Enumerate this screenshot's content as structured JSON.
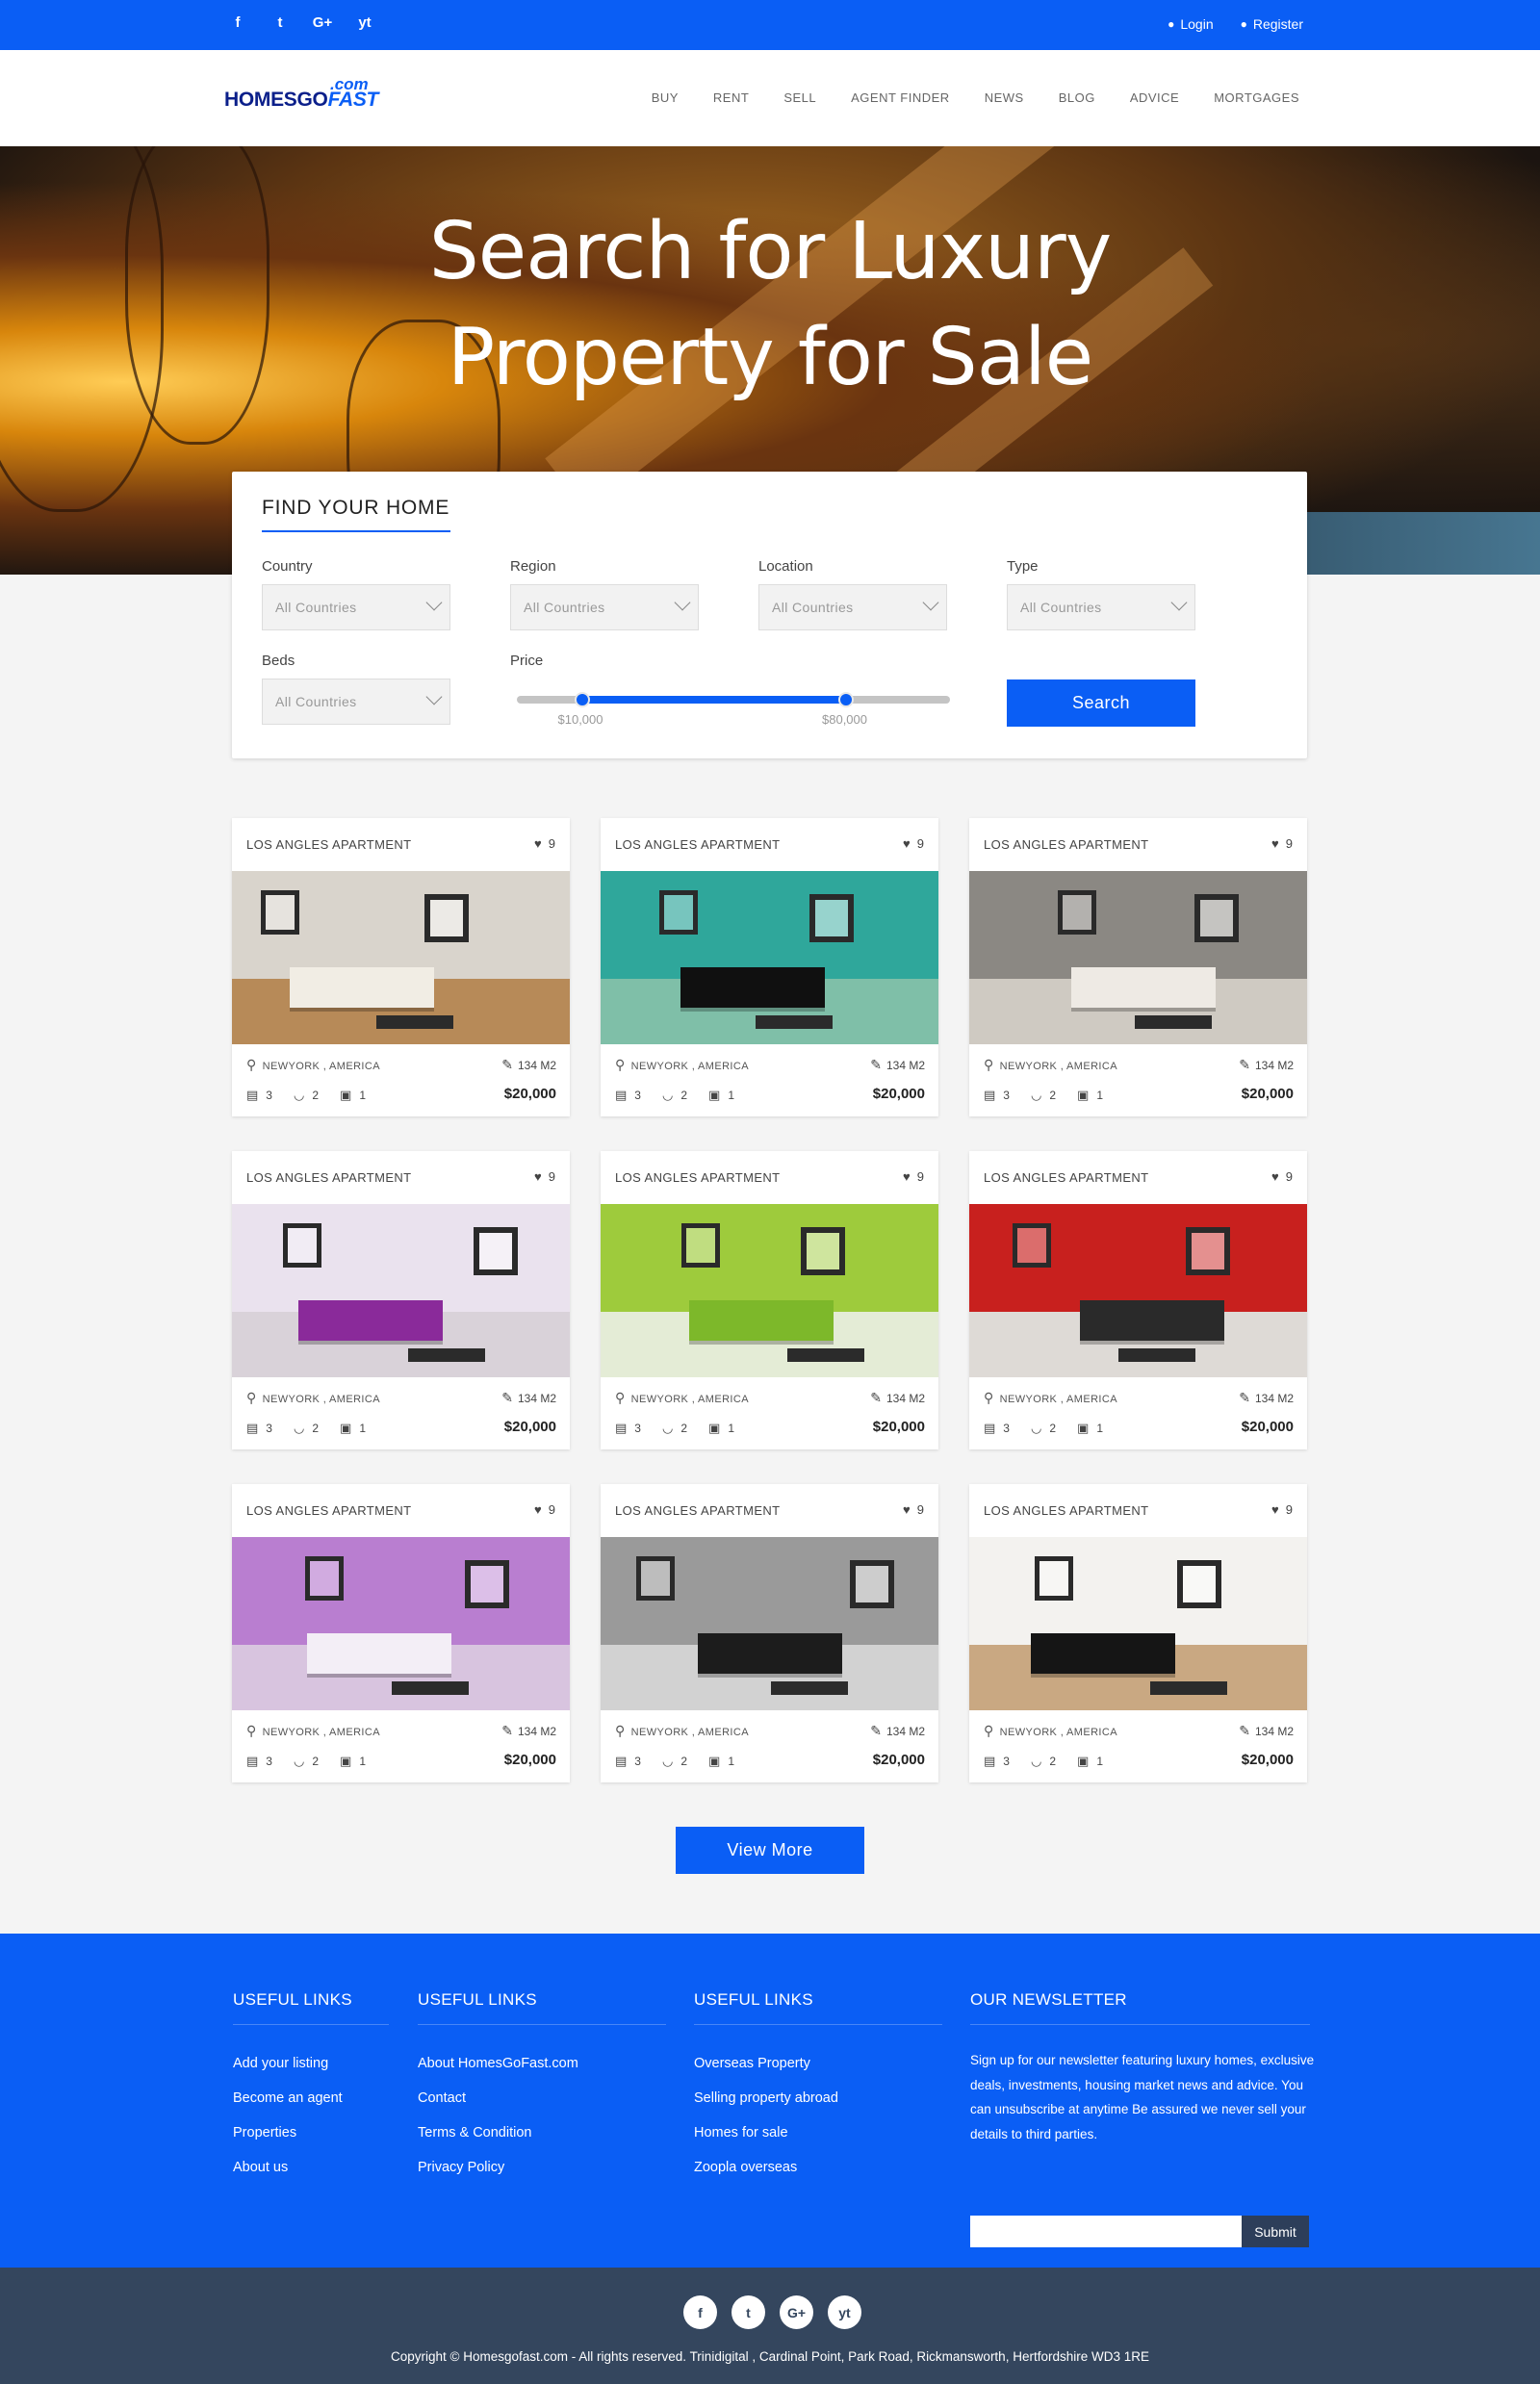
{
  "topbar": {
    "social": [
      "f",
      "t",
      "G+",
      "yt"
    ],
    "login": "Login",
    "register": "Register"
  },
  "logo": {
    "dotcom": ".com",
    "word_a": "HOMESGO",
    "word_b": "FAST"
  },
  "nav": [
    "BUY",
    "RENT",
    "SELL",
    "AGENT FINDER",
    "NEWS",
    "BLOG",
    "ADVICE",
    "MORTGAGES"
  ],
  "hero": {
    "line1": "Search for Luxury",
    "line2": "Property for Sale"
  },
  "search": {
    "title": "FIND YOUR HOME",
    "country": {
      "label": "Country",
      "value": "All Countries"
    },
    "region": {
      "label": "Region",
      "value": "All Countries"
    },
    "location": {
      "label": "Location",
      "value": "All Countries"
    },
    "type": {
      "label": "Type",
      "value": "All Countries"
    },
    "beds": {
      "label": "Beds",
      "value": "All Countries"
    },
    "price": {
      "label": "Price",
      "min": "$10,000",
      "max": "$80,000",
      "min_fraction": 0.15,
      "max_fraction": 0.76
    },
    "button": "Search"
  },
  "listings": [
    {
      "title": "LOS ANGLES APARTMENT",
      "likes": "9",
      "location": "NEWYORK , AMERICA",
      "area": "134 M2",
      "beds": "3",
      "baths": "2",
      "garage": "1",
      "price": "$20,000",
      "wall": "#d9d4cc",
      "floor": "#b78a58",
      "accent": "#f1ede4"
    },
    {
      "title": "LOS ANGLES APARTMENT",
      "likes": "9",
      "location": "NEWYORK , AMERICA",
      "area": "134 M2",
      "beds": "3",
      "baths": "2",
      "garage": "1",
      "price": "$20,000",
      "wall": "#2fa79b",
      "floor": "#7fbfa8",
      "accent": "#101010"
    },
    {
      "title": "LOS ANGLES APARTMENT",
      "likes": "9",
      "location": "NEWYORK , AMERICA",
      "area": "134 M2",
      "beds": "3",
      "baths": "2",
      "garage": "1",
      "price": "$20,000",
      "wall": "#8b8883",
      "floor": "#cfcac2",
      "accent": "#eeeae4"
    },
    {
      "title": "LOS ANGLES APARTMENT",
      "likes": "9",
      "location": "NEWYORK , AMERICA",
      "area": "134 M2",
      "beds": "3",
      "baths": "2",
      "garage": "1",
      "price": "$20,000",
      "wall": "#eae2ee",
      "floor": "#d9d2d9",
      "accent": "#8a2a9a"
    },
    {
      "title": "LOS ANGLES APARTMENT",
      "likes": "9",
      "location": "NEWYORK , AMERICA",
      "area": "134 M2",
      "beds": "3",
      "baths": "2",
      "garage": "1",
      "price": "$20,000",
      "wall": "#9ecb3c",
      "floor": "#e4ecd6",
      "accent": "#7db82a"
    },
    {
      "title": "LOS ANGLES APARTMENT",
      "likes": "9",
      "location": "NEWYORK , AMERICA",
      "area": "134 M2",
      "beds": "3",
      "baths": "2",
      "garage": "1",
      "price": "$20,000",
      "wall": "#c8201e",
      "floor": "#dedad6",
      "accent": "#2a2a2a"
    },
    {
      "title": "LOS ANGLES APARTMENT",
      "likes": "9",
      "location": "NEWYORK , AMERICA",
      "area": "134 M2",
      "beds": "3",
      "baths": "2",
      "garage": "1",
      "price": "$20,000",
      "wall": "#b97ed0",
      "floor": "#d8c4df",
      "accent": "#f3eef6"
    },
    {
      "title": "LOS ANGLES APARTMENT",
      "likes": "9",
      "location": "NEWYORK , AMERICA",
      "area": "134 M2",
      "beds": "3",
      "baths": "2",
      "garage": "1",
      "price": "$20,000",
      "wall": "#9a9a9a",
      "floor": "#d2d2d2",
      "accent": "#1c1c1c"
    },
    {
      "title": "LOS ANGLES APARTMENT",
      "likes": "9",
      "location": "NEWYORK , AMERICA",
      "area": "134 M2",
      "beds": "3",
      "baths": "2",
      "garage": "1",
      "price": "$20,000",
      "wall": "#f3f2ef",
      "floor": "#c9a882",
      "accent": "#151515"
    }
  ],
  "view_more": "View More",
  "footer": {
    "col1": {
      "title": "USEFUL LINKS",
      "links": [
        "Add your listing",
        "Become an agent",
        "Properties",
        "About us"
      ]
    },
    "col2": {
      "title": "USEFUL LINKS",
      "links": [
        "About HomesGoFast.com",
        "Contact",
        "Terms & Condition",
        "Privacy Policy"
      ]
    },
    "col3": {
      "title": "USEFUL LINKS",
      "links": [
        "Overseas Property",
        "Selling property abroad",
        "Homes for sale",
        "Zoopla overseas"
      ]
    },
    "newsletter": {
      "title": "OUR NEWSLETTER",
      "text": "Sign up for our newsletter featuring luxury homes, exclusive deals, investments, housing market news and advice. You can unsubscribe at anytime Be assured we never sell your details to third parties.",
      "placeholder": "",
      "submit": "Submit"
    }
  },
  "bottom": {
    "social": [
      "f",
      "t",
      "G+",
      "yt"
    ],
    "copyright": "Copyright © Homesgofast.com - All rights reserved. Trinidigital , Cardinal Point, Park Road, Rickmansworth, Hertfordshire WD3 1RE"
  },
  "colors": {
    "brand": "#0a5ef5",
    "footer_dark": "#34465e"
  }
}
